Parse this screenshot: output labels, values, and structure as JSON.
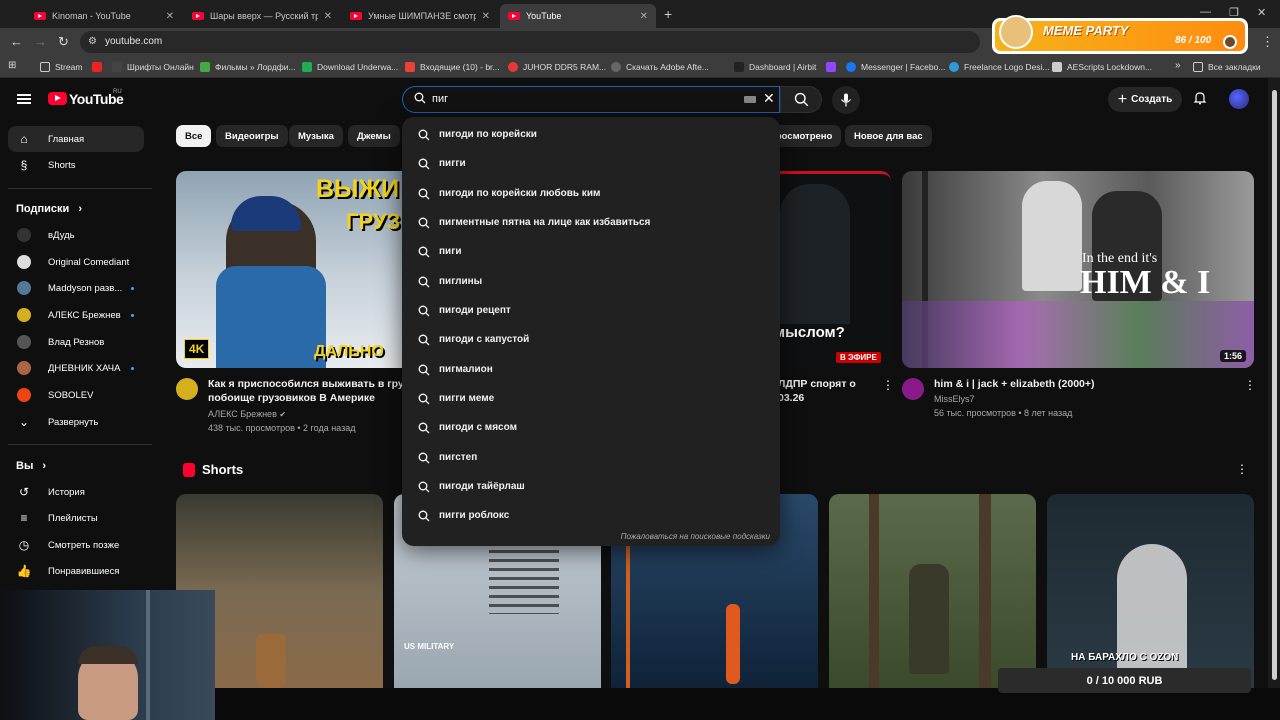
{
  "browser": {
    "tabs": [
      {
        "label": "Kinoman - YouTube"
      },
      {
        "label": "Шары вверх — Русский трейл"
      },
      {
        "label": "Умные ШИМПАНЗЕ смотрят"
      },
      {
        "label": "YouTube"
      }
    ],
    "url": "youtube.com",
    "bookmarks": [
      {
        "label": "Stream",
        "color": "#cccccc"
      },
      {
        "label": "Шрифты Онлайн",
        "color": "#444444"
      },
      {
        "label": "Фильмы » Лордфи...",
        "color": "#44aa44"
      },
      {
        "label": "Download Underwa...",
        "color": "#22aa55"
      },
      {
        "label": "Входящие (10) - br...",
        "color": "#ea4335"
      },
      {
        "label": "JUHOR DDR5 RAM...",
        "color": "#e53935"
      },
      {
        "label": "Скачать Adobe Afte...",
        "color": "#666666"
      },
      {
        "label": "Dashboard | Airbit",
        "color": "#222222"
      },
      {
        "label": "Messenger | Facebo...",
        "color": "#1877f2"
      },
      {
        "label": "Freelance Logo Desi...",
        "color": "#2e9bd8"
      },
      {
        "label": "AEScripts Lockdown...",
        "color": "#cccccc"
      }
    ],
    "all_bookmarks": "Все закладки"
  },
  "meme_party": {
    "title": "MEME PARTY",
    "count": "86 / 100"
  },
  "header": {
    "logo": "YouTube",
    "region": "RU",
    "search_value": "пиг",
    "create_label": "Создать"
  },
  "sidebar": {
    "main": [
      {
        "label": "Главная",
        "icon": "home-icon"
      },
      {
        "label": "Shorts",
        "icon": "shorts-icon"
      }
    ],
    "subs_title": "Подписки",
    "subscriptions": [
      {
        "label": "вДудь",
        "color": "#333333"
      },
      {
        "label": "Original Comediant",
        "color": "#dddddd"
      },
      {
        "label": "Maddyson разв...",
        "color": "#557799",
        "dot": true
      },
      {
        "label": "АЛЕКС Брежнев",
        "color": "#d4b020",
        "dot": true
      },
      {
        "label": "Влад Резнов",
        "color": "#555555"
      },
      {
        "label": "ДНЕВНИК ХАЧА",
        "color": "#aa6644",
        "dot": true
      },
      {
        "label": "SOBOLEV",
        "color": "#ee4411"
      }
    ],
    "expand_label": "Развернуть",
    "you_title": "Вы",
    "you_items": [
      {
        "label": "История",
        "icon": "history-icon"
      },
      {
        "label": "Плейлисты",
        "icon": "playlist-icon"
      },
      {
        "label": "Смотреть позже",
        "icon": "clock-icon"
      },
      {
        "label": "Понравившиеся",
        "icon": "like-icon"
      }
    ]
  },
  "chips": [
    "Все",
    "Видеоигры",
    "Музыка",
    "Джемы",
    "Просмотрено",
    "Новое для вас"
  ],
  "videos": [
    {
      "title_line1": "Как я приспособился выживать в груз",
      "title_line2": "побоище грузовиков В Америке",
      "channel": "АЛЕКС Брежнев",
      "meta": "438 тыс. просмотров • 2 года назад",
      "thumb_text": "ВЫЖИ",
      "thumb_text2": "ГРУЗ",
      "thumb_text3": "ДАЛЬНО",
      "badge": "4K"
    },
    {
      "title_line1": "ЛДПР спорят о",
      "title_line2": "03.26",
      "thumb_text": "мыслом?",
      "live": "В ЭФИРЕ"
    },
    {
      "title": "him & i | jack + elizabeth (2000+)",
      "channel": "MissElys7",
      "meta": "56 тыс. просмотров • 8 лет назад",
      "thumb_text_small": "In the end it's",
      "thumb_text_big": "HIM & I",
      "duration": "1:56"
    }
  ],
  "shorts": {
    "title": "Shorts",
    "items": [
      {
        "color": "#6a5a44"
      },
      {
        "color": "#aab4bd",
        "text": "US MILITARY"
      },
      {
        "color": "#1d3a58"
      },
      {
        "color": "#4a5a3a"
      },
      {
        "color": "#27323a",
        "text": "НА БАРАХЛО С OZON"
      }
    ]
  },
  "suggestions": [
    "пигоди по корейски",
    "пигги",
    "пигоди по корейски любовь ким",
    "пигментные пятна на лице как избавиться",
    "пиги",
    "пиглины",
    "пигоди рецепт",
    "пигоди с капустой",
    "пигмалион",
    "пигги меме",
    "пигоди с мясом",
    "пигстеп",
    "пигоди тайёрлаш",
    "пигги роблокс"
  ],
  "suggest_report": "Пожаловаться на поисковые подсказки",
  "donation": {
    "text": "0 / 10 000 RUB"
  }
}
